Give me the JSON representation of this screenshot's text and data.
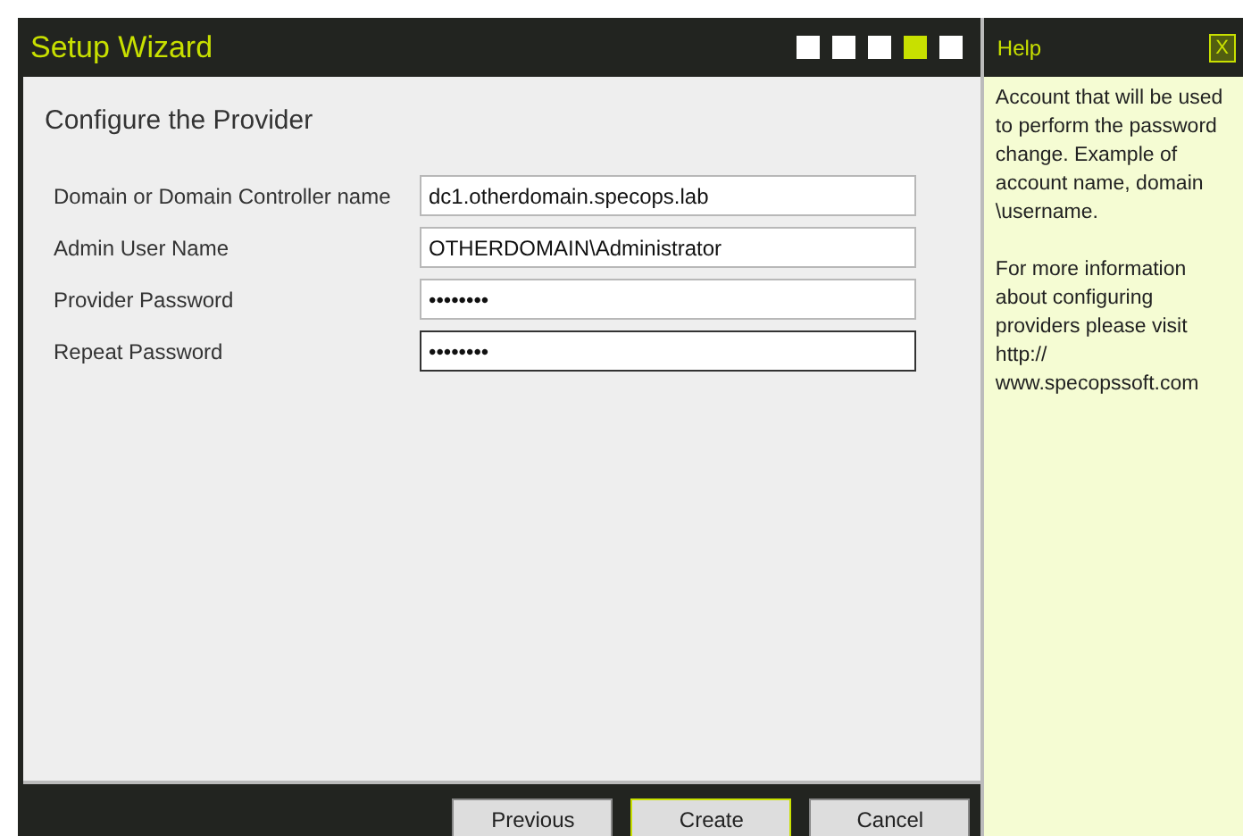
{
  "window": {
    "title": "Setup Wizard"
  },
  "steps": [
    {
      "selected": false
    },
    {
      "selected": false
    },
    {
      "selected": false
    },
    {
      "selected": true
    },
    {
      "selected": false
    }
  ],
  "page_title": "Configure the Provider",
  "fields": [
    {
      "label": "Domain or Domain Controller name",
      "value": "dc1.otherdomain.specops.lab",
      "focused": false
    },
    {
      "label": "Admin User Name",
      "value": "OTHERDOMAIN\\Administrator",
      "focused": false
    },
    {
      "label": "Provider Password",
      "value": "••••••••",
      "focused": false
    },
    {
      "label": "Repeat Password",
      "value": "••••••••",
      "focused": true
    }
  ],
  "buttons": [
    {
      "label": "Previous",
      "default": false
    },
    {
      "label": "Create",
      "default": true
    },
    {
      "label": "Cancel",
      "default": false
    }
  ],
  "help": {
    "title": "Help",
    "close": "X",
    "paragraphs": [
      "Account that will be used to perform the password change. Example of account name, domain \\username.",
      "For more information about configuring providers please visit http:// www.specopssoft.com"
    ]
  }
}
